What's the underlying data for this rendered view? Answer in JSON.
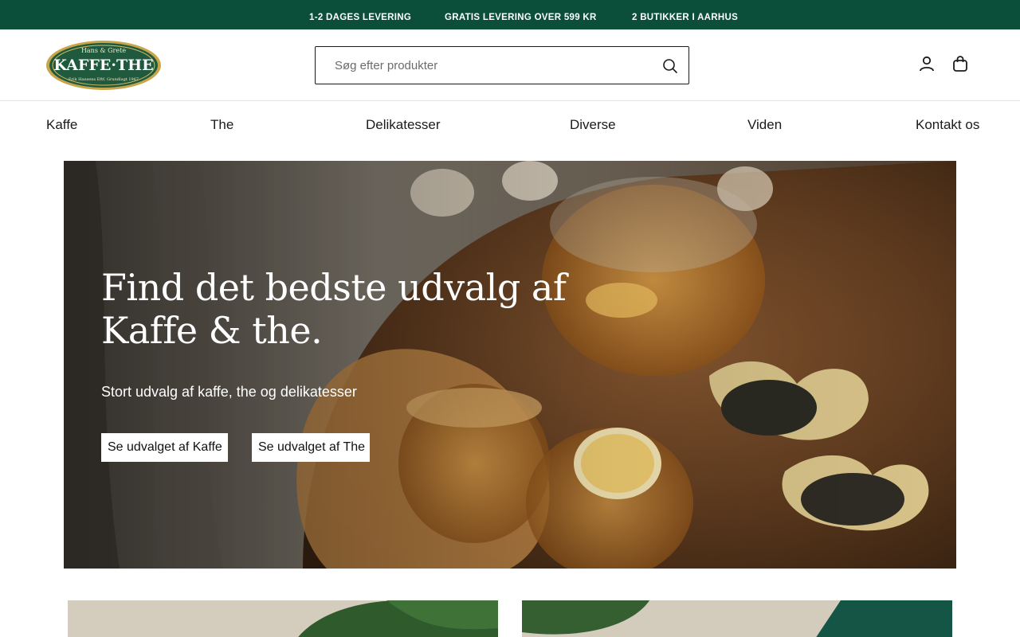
{
  "announcement": [
    "1-2 DAGES LEVERING",
    "GRATIS LEVERING OVER 599 KR",
    "2 BUTIKKER I AARHUS"
  ],
  "logo": {
    "top_text": "Hans & Grete",
    "main_text": "KAFFE·THE",
    "bottom_text": "Erik Hansens Eftf. Grundlagt 1967"
  },
  "search": {
    "placeholder": "Søg efter produkter",
    "icon": "search-icon"
  },
  "header_icons": [
    "account-icon",
    "cart-icon"
  ],
  "nav": [
    "Kaffe",
    "The",
    "Delikatesser",
    "Diverse",
    "Viden",
    "Kontakt os"
  ],
  "hero": {
    "heading": "Find det bedste udvalg af Kaffe & the.",
    "subheading": "Stort udvalg af kaffe, the og delikatesser",
    "buttons": [
      "Se udvalget af Kaffe",
      "Se udvalget af The"
    ]
  },
  "colors": {
    "brand_green": "#0b4f3b",
    "text": "#1b1b1b",
    "logo_gold": "#c9a54a"
  }
}
